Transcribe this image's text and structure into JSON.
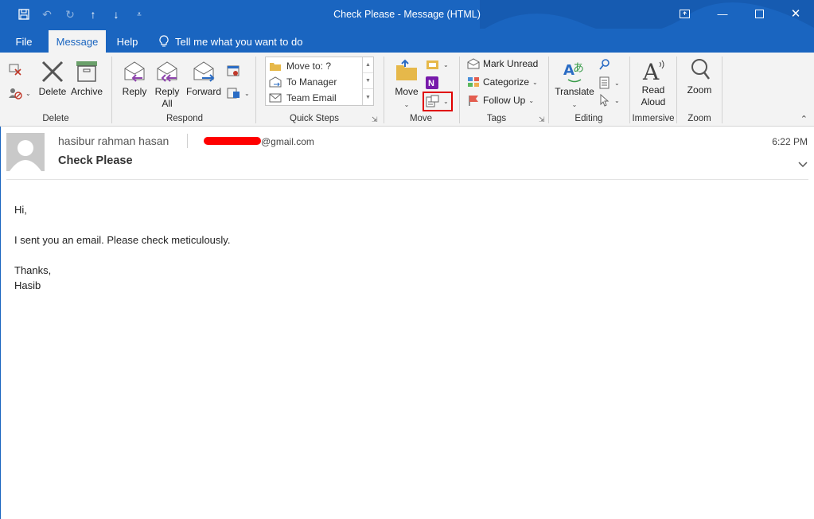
{
  "window": {
    "title": "Check Please  -  Message (HTML)"
  },
  "menu": {
    "tabs": [
      "File",
      "Message",
      "Help"
    ],
    "tell_me": "Tell me what you want to do"
  },
  "ribbon": {
    "delete_group": {
      "label": "Delete",
      "delete": "Delete",
      "archive": "Archive"
    },
    "respond_group": {
      "label": "Respond",
      "reply": "Reply",
      "reply_all_1": "Reply",
      "reply_all_2": "All",
      "forward": "Forward"
    },
    "quick_steps": {
      "label": "Quick Steps",
      "items": [
        "Move to: ?",
        "To Manager",
        "Team Email"
      ]
    },
    "move_group": {
      "label": "Move",
      "move": "Move"
    },
    "tags_group": {
      "label": "Tags",
      "mark_unread": "Mark Unread",
      "categorize": "Categorize",
      "follow_up": "Follow Up"
    },
    "editing_group": {
      "label": "Editing",
      "translate": "Translate"
    },
    "immersive_group": {
      "label": "Immersive",
      "read_aloud_1": "Read",
      "read_aloud_2": "Aloud"
    },
    "zoom_group": {
      "label": "Zoom",
      "zoom": "Zoom"
    }
  },
  "message": {
    "sender": "hasibur rahman hasan",
    "email_suffix": "@gmail.com",
    "time": "6:22 PM",
    "subject": "Check Please",
    "body": {
      "greeting": "Hi,",
      "line1": "I sent you an email. Please check meticulously.",
      "closing": "Thanks,",
      "signature": "Hasib"
    }
  },
  "colors": {
    "accent": "#1a65c0",
    "highlight": "#e00000",
    "ribbon_bg": "#f3f3f3"
  }
}
